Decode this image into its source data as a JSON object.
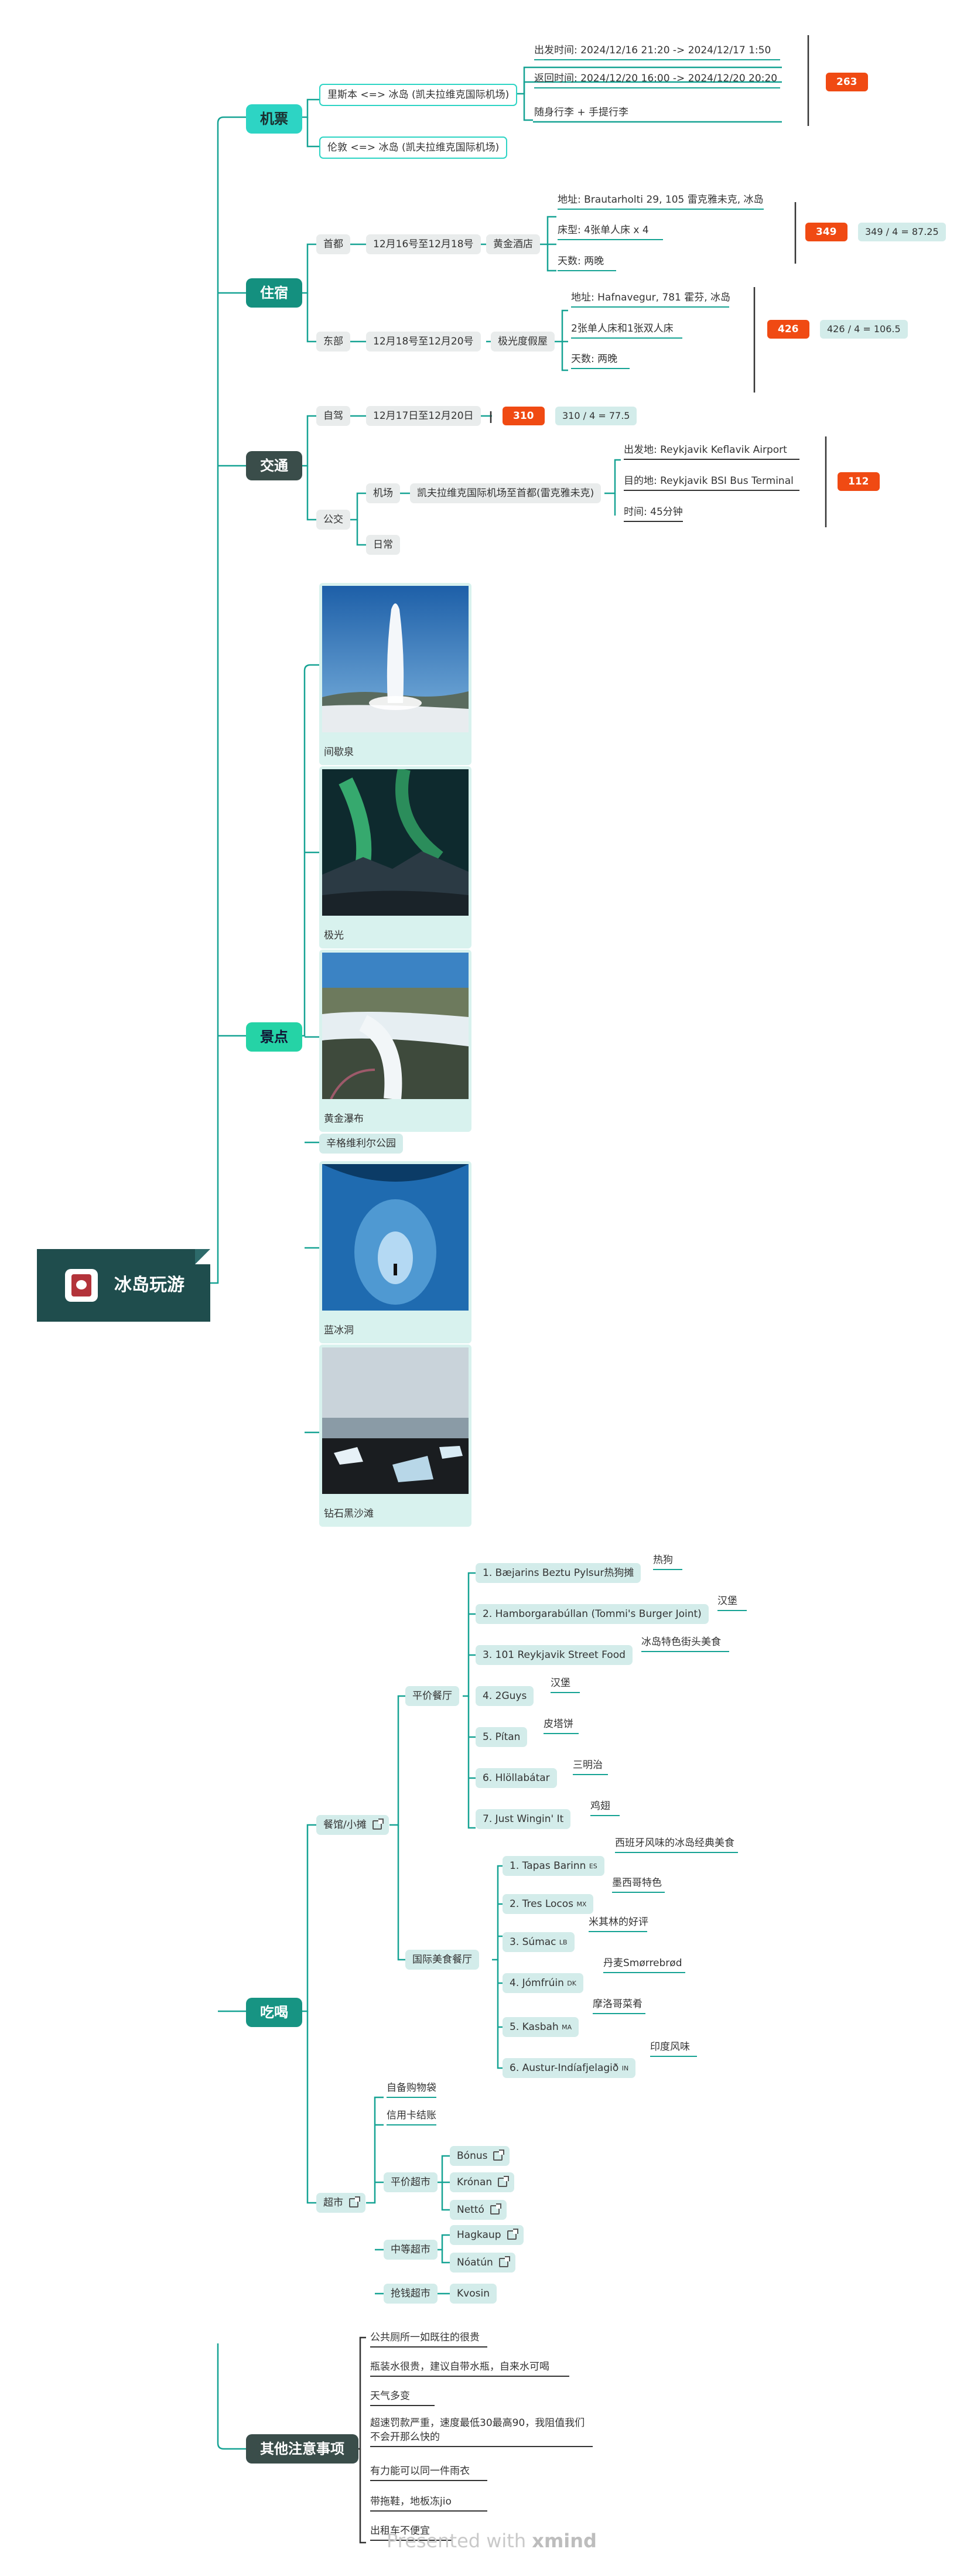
{
  "root": {
    "title": "冰岛玩游"
  },
  "branches": {
    "flight": "机票",
    "stay": "住宿",
    "transport": "交通",
    "sights": "景点",
    "food": "吃喝",
    "notes": "其他注意事项"
  },
  "flight": {
    "route1": "里斯本 <=> 冰岛 (凯夫拉维克国际机场)",
    "route2": "伦敦 <=> 冰岛 (凯夫拉维克国际机场)",
    "depart": "出发时间:  2024/12/16 21:20 -> 2024/12/17 1:50",
    "return": "返回时间:  2024/12/20 16:00 -> 2024/12/20 20:20",
    "luggage": "随身行李 + 手提行李",
    "cost": "263"
  },
  "stay": {
    "capital": "首都",
    "capital_dates": "12月16号至12月18号",
    "capital_hotel": "黄金酒店",
    "capital_addr": "地址:  Brautarholti 29, 105 雷克雅未克, 冰岛",
    "capital_bed": "床型:   4张单人床  x 4",
    "capital_days": "天数:  两晚",
    "capital_cost": "349",
    "capital_eq": "349 / 4 = 87.25",
    "east": "东部",
    "east_dates": "12月18号至12月20号",
    "east_hotel": "极光度假屋",
    "east_addr": "地址:  Hafnavegur, 781 霍芬, 冰岛",
    "east_bed": "2张单人床和1张双人床",
    "east_days": "天数:  两晚",
    "east_cost": "426",
    "east_eq": "426 / 4 = 106.5"
  },
  "transport": {
    "self": "自驾",
    "self_dates": "12月17日至12月20日",
    "self_cost": "310",
    "self_eq": "310 / 4 = 77.5",
    "bus": "公交",
    "airport": "机场",
    "daily": "日常",
    "airport_route": "凯夫拉维克国际机场至首都(雷克雅未克)",
    "from": "出发地:  Reykjavik Keflavik Airport",
    "to": "目的地:  Reykjavik BSI Bus Terminal",
    "time": "时间:   45分钟",
    "bus_cost": "112"
  },
  "sights": [
    {
      "caption": "间歇泉",
      "icon": "geyser-photo"
    },
    {
      "caption": "极光",
      "icon": "aurora-photo"
    },
    {
      "caption": "黄金瀑布",
      "icon": "waterfall-photo"
    },
    {
      "caption": "辛格维利尔公园",
      "icon": ""
    },
    {
      "caption": "蓝冰洞",
      "icon": "ice-cave-photo"
    },
    {
      "caption": "钻石黑沙滩",
      "icon": "black-beach-photo"
    }
  ],
  "food": {
    "stalls": "餐馆/小摊",
    "cheap": "平价餐厅",
    "intl": "国际美食餐厅",
    "cheap_list": [
      {
        "name": "1. Bæjarins Beztu Pylsur热狗摊",
        "note": "热狗"
      },
      {
        "name": "2. Hamborgarabúllan (Tommi's Burger Joint)",
        "note": "汉堡"
      },
      {
        "name": "3. 101 Reykjavik Street Food",
        "note": "冰岛特色街头美食"
      },
      {
        "name": "4. 2Guys",
        "note": "汉堡"
      },
      {
        "name": "5. Pítan",
        "note": "皮塔饼"
      },
      {
        "name": "6. Hlöllabátar",
        "note": "三明治"
      },
      {
        "name": "7. Just Wingin' It",
        "note": "鸡翅"
      }
    ],
    "intl_list": [
      {
        "name": "1. Tapas Barinn",
        "flag": "ES",
        "note": "西班牙风味的冰岛经典美食"
      },
      {
        "name": "2. Tres Locos",
        "flag": "MX",
        "note": "墨西哥特色"
      },
      {
        "name": "3. Súmac",
        "flag": "LB",
        "note": "米其林的好评"
      },
      {
        "name": "4. Jómfrúin",
        "flag": "DK",
        "note": "丹麦Smørrebrød"
      },
      {
        "name": "5. Kasbah",
        "flag": "MA",
        "note": "摩洛哥菜肴"
      },
      {
        "name": "6. Austur-Indíafjelagið",
        "flag": "IN",
        "note": "印度风味"
      }
    ],
    "market": "超市",
    "market_notes": [
      "自备购物袋",
      "信用卡结账"
    ],
    "cheap_market": "平价超市",
    "cheap_markets": [
      "Bónus",
      "Krónan",
      "Nettó"
    ],
    "mid_market": "中等超市",
    "mid_markets": [
      "Hagkaup",
      "Nóatún"
    ],
    "rich_market": "抢钱超市",
    "rich_markets": [
      "Kvosin"
    ]
  },
  "notes": [
    "公共厕所一如既往的很贵",
    "瓶装水很贵，建议自带水瓶，自来水可喝",
    "天气多变",
    "超速罚款严重，速度最低30最高90，我阻值我们",
    "不会开那么快的",
    "有力能可以同一件雨衣",
    "带拖鞋，地板冻jio",
    "出租车不便宜"
  ],
  "footer": {
    "prefix": "Presented with ",
    "brand": "xmind"
  },
  "colors": {
    "teal": "#2dd4c4",
    "line": "#16a394",
    "tag": "#f04a13",
    "root": "#1f4d4d"
  }
}
